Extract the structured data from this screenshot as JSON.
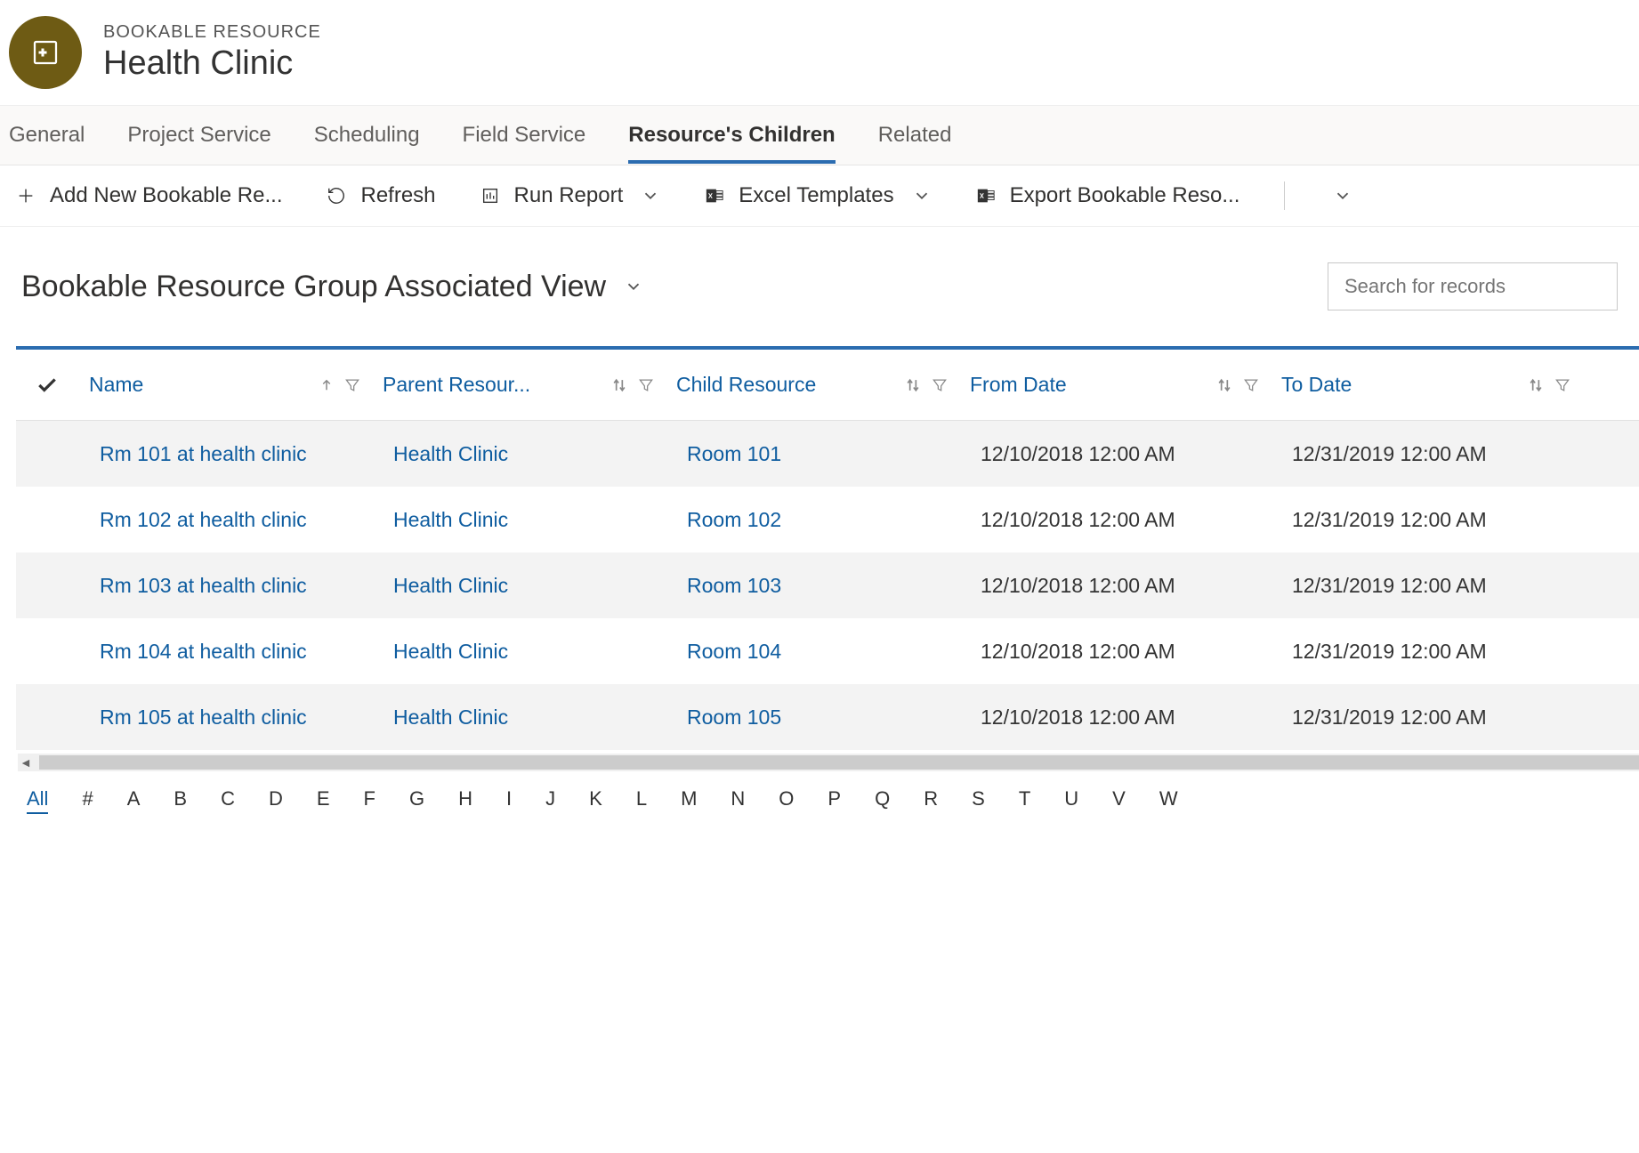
{
  "header": {
    "entity_label": "BOOKABLE RESOURCE",
    "title": "Health Clinic"
  },
  "tabs": [
    {
      "label": "General",
      "active": false
    },
    {
      "label": "Project Service",
      "active": false
    },
    {
      "label": "Scheduling",
      "active": false
    },
    {
      "label": "Field Service",
      "active": false
    },
    {
      "label": "Resource's Children",
      "active": true
    },
    {
      "label": "Related",
      "active": false
    }
  ],
  "commands": {
    "add_new": "Add New Bookable Re...",
    "refresh": "Refresh",
    "run_report": "Run Report",
    "excel_templates": "Excel Templates",
    "export": "Export Bookable Reso..."
  },
  "view": {
    "title": "Bookable Resource Group Associated View",
    "search_placeholder": "Search for records"
  },
  "columns": {
    "name": "Name",
    "parent": "Parent Resour...",
    "child": "Child Resource",
    "from": "From Date",
    "to": "To Date"
  },
  "rows": [
    {
      "name": "Rm 101 at health clinic",
      "parent": "Health Clinic",
      "child": "Room 101",
      "from": "12/10/2018 12:00 AM",
      "to": "12/31/2019 12:00 AM"
    },
    {
      "name": "Rm 102 at health clinic",
      "parent": "Health Clinic",
      "child": "Room 102",
      "from": "12/10/2018 12:00 AM",
      "to": "12/31/2019 12:00 AM"
    },
    {
      "name": "Rm 103 at health clinic",
      "parent": "Health Clinic",
      "child": "Room 103",
      "from": "12/10/2018 12:00 AM",
      "to": "12/31/2019 12:00 AM"
    },
    {
      "name": "Rm 104 at health clinic",
      "parent": "Health Clinic",
      "child": "Room 104",
      "from": "12/10/2018 12:00 AM",
      "to": "12/31/2019 12:00 AM"
    },
    {
      "name": "Rm 105 at health clinic",
      "parent": "Health Clinic",
      "child": "Room 105",
      "from": "12/10/2018 12:00 AM",
      "to": "12/31/2019 12:00 AM"
    }
  ],
  "index_bar": [
    "All",
    "#",
    "A",
    "B",
    "C",
    "D",
    "E",
    "F",
    "G",
    "H",
    "I",
    "J",
    "K",
    "L",
    "M",
    "N",
    "O",
    "P",
    "Q",
    "R",
    "S",
    "T",
    "U",
    "V",
    "W"
  ]
}
